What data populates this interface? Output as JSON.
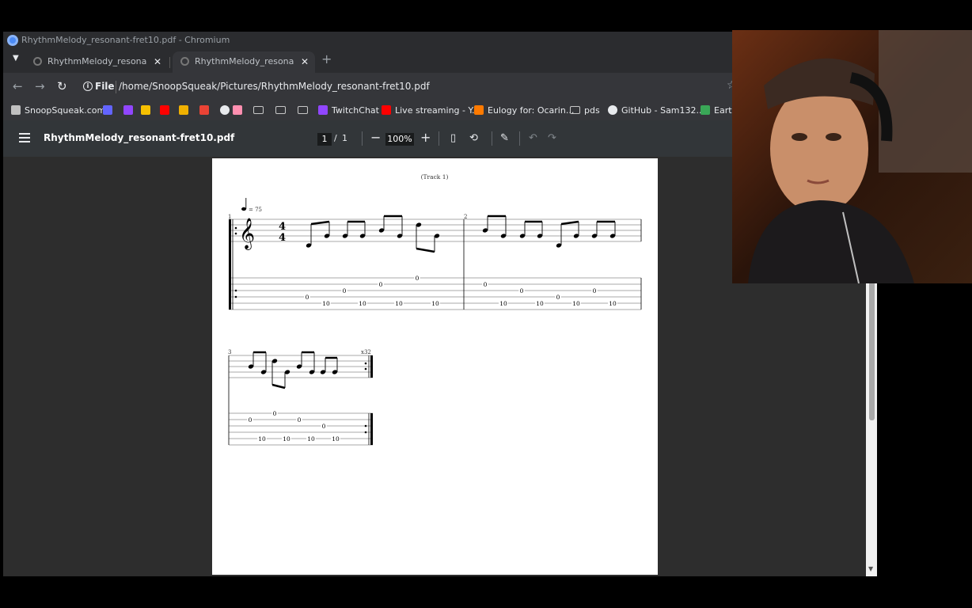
{
  "window": {
    "title": "RhythmMelody_resonant-fret10.pdf - Chromium"
  },
  "tabs": [
    {
      "label": "RhythmMelody_resonant-fr",
      "close": "✕"
    },
    {
      "label": "RhythmMelody_resonant-fr",
      "close": "✕"
    }
  ],
  "new_tab": "+",
  "address": {
    "scheme": "File",
    "url": "/home/SnoopSqueak/Pictures/RhythmMelody_resonant-fret10.pdf"
  },
  "bookmarks": [
    {
      "label": "SnoopSqueak.com",
      "icon": "site-icon",
      "color": "#c0c0c0"
    },
    {
      "label": "",
      "icon": "mastodon-icon",
      "color": "#6364ff"
    },
    {
      "label": "",
      "icon": "twitch-icon",
      "color": "#9146ff"
    },
    {
      "label": "",
      "icon": "abc-icon",
      "color": "#f7c000"
    },
    {
      "label": "",
      "icon": "youtube-icon",
      "color": "#ff0000"
    },
    {
      "label": "",
      "icon": "g-icon",
      "color": "#f0b000"
    },
    {
      "label": "",
      "icon": "gmail-icon",
      "color": "#ea4335"
    },
    {
      "label": "",
      "icon": "globe-icon",
      "color": "#e8eaed"
    },
    {
      "label": "",
      "icon": "heart-icon",
      "color": "#ff8fb0"
    },
    {
      "label": "",
      "icon": "folder-icon",
      "color": "#c8c8c8"
    },
    {
      "label": "",
      "icon": "folder-icon",
      "color": "#c8c8c8"
    },
    {
      "label": "",
      "icon": "folder-icon",
      "color": "#c8c8c8"
    },
    {
      "label": "TwitchChat",
      "icon": "twitch-icon",
      "color": "#9146ff"
    },
    {
      "label": "Live streaming - Y...",
      "icon": "youtube-icon",
      "color": "#ff0000"
    },
    {
      "label": "Eulogy for: Ocarin...",
      "icon": "rg-icon",
      "color": "#ff7a00"
    },
    {
      "label": "pds",
      "icon": "folder-icon",
      "color": "#c8c8c8"
    },
    {
      "label": "GitHub - Sam132...",
      "icon": "github-icon",
      "color": "#e8eaed"
    },
    {
      "label": "Earth",
      "icon": "tv-icon",
      "color": "#3aa757"
    }
  ],
  "pdf_toolbar": {
    "title": "RhythmMelody_resonant-fret10.pdf",
    "page_current": "1",
    "page_sep": "/",
    "page_total": "1",
    "zoom": "100%",
    "zoom_out": "−",
    "zoom_in": "+"
  },
  "score": {
    "header": "(Track 1)",
    "tempo": "= 75",
    "time_signature": [
      "4",
      "4"
    ],
    "measure_numbers": [
      "1",
      "2",
      "3"
    ],
    "repeat_count": "x32",
    "tab_numbers": {
      "m1": [
        "0",
        "10",
        "0",
        "10",
        "0",
        "10",
        "0",
        "10"
      ],
      "m2": [
        "0",
        "10",
        "0",
        "10",
        "0",
        "10",
        "0",
        "10"
      ],
      "m3": [
        "0",
        "10",
        "0",
        "10",
        "0",
        "10",
        "0",
        "10"
      ]
    }
  }
}
